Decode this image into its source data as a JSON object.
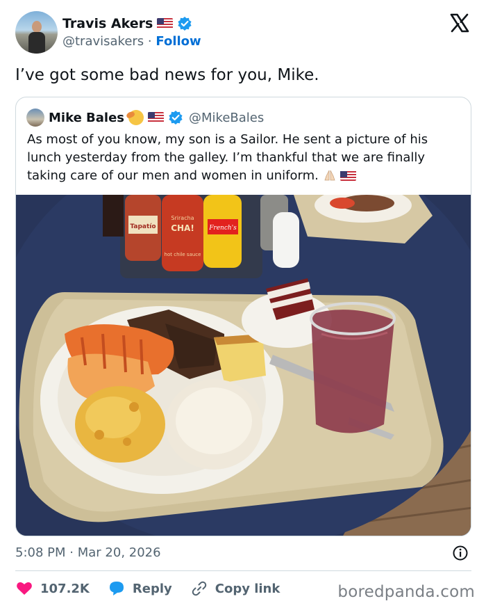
{
  "author": {
    "name": "Travis Akers",
    "handle": "@travisakers",
    "separator": "·",
    "follow_label": "Follow"
  },
  "tweet": {
    "text": "I’ve got some bad news for you, Mike."
  },
  "quoted": {
    "name": "Mike Bales",
    "handle": "@MikeBales",
    "text": "As most of you know, my son is a Sailor. He sent a picture of his lunch yesterday from the galley. I’m thankful that we are finally taking care of our men and women in uniform.",
    "photo": {
      "bottle_labels": [
        "Sriracha",
        "CHA!",
        "hot chile sauce",
        "French's",
        "Tapatío"
      ]
    }
  },
  "meta": {
    "time": "5:08 PM",
    "separator": "·",
    "date": "Mar 20, 2026"
  },
  "actions": {
    "likes": "107.2K",
    "reply_label": "Reply",
    "copy_label": "Copy link"
  },
  "watermark": "boredpanda.com",
  "colors": {
    "accent": "#006fd6",
    "verified": "#1d9bf0",
    "like": "#f91880",
    "reply": "#1d9bf0",
    "secondary_text": "#536471"
  }
}
